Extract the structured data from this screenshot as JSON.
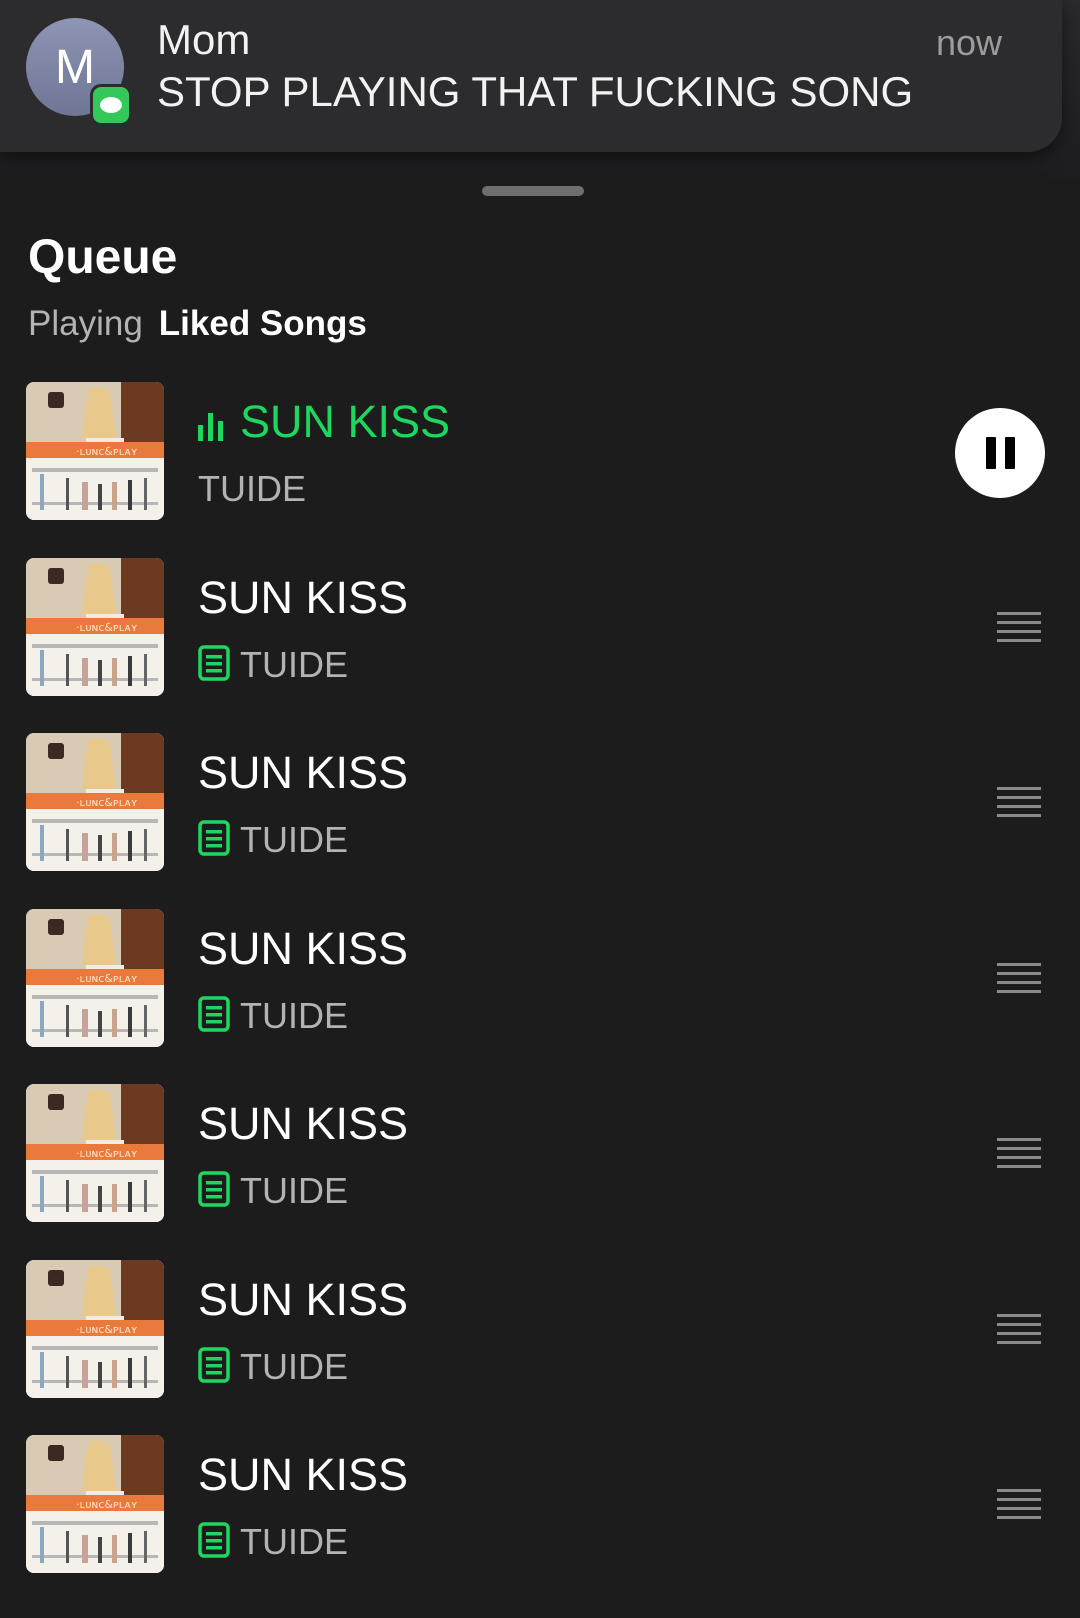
{
  "notification": {
    "avatar_letter": "M",
    "sender": "Mom",
    "message": "STOP PLAYING THAT FUCKING SONG",
    "time": "now",
    "app_icon": "messages-icon",
    "app_color": "#34c759"
  },
  "queue": {
    "title": "Queue",
    "playing_label": "Playing",
    "context": "Liked Songs"
  },
  "colors": {
    "accent": "#1ed760",
    "background": "#1c1c1c"
  },
  "tracks": [
    {
      "title": "SUN KISS",
      "artist": "TUIDE",
      "now_playing": true
    },
    {
      "title": "SUN KISS",
      "artist": "TUIDE",
      "lyrics": true
    },
    {
      "title": "SUN KISS",
      "artist": "TUIDE",
      "lyrics": true
    },
    {
      "title": "SUN KISS",
      "artist": "TUIDE",
      "lyrics": true
    },
    {
      "title": "SUN KISS",
      "artist": "TUIDE",
      "lyrics": true
    },
    {
      "title": "SUN KISS",
      "artist": "TUIDE",
      "lyrics": true
    },
    {
      "title": "SUN KISS",
      "artist": "TUIDE",
      "lyrics": true
    }
  ]
}
